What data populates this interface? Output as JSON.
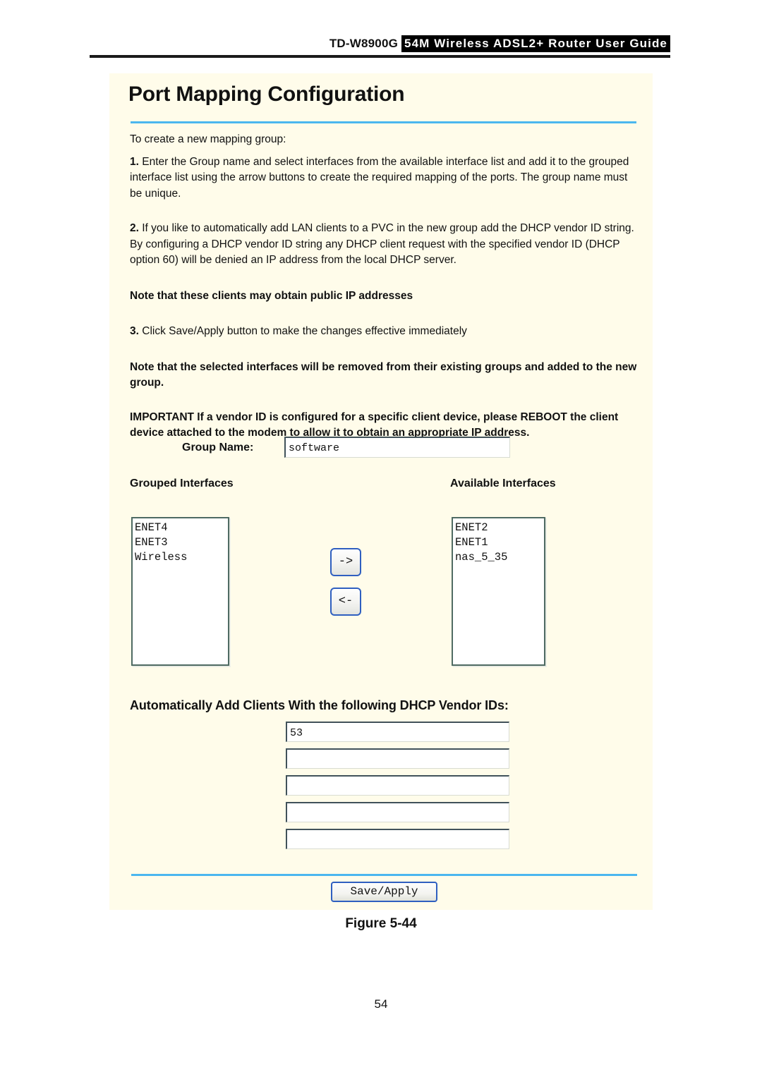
{
  "header": {
    "model": "TD-W8900G",
    "product": "54M Wireless ADSL2+ Router User Guide"
  },
  "panel": {
    "title": "Port Mapping Configuration",
    "intro": "To create a new mapping group:",
    "step1_num": "1.",
    "step1_text": " Enter the Group name and select interfaces from the available interface list and add it to the grouped interface list using the arrow buttons to create the required mapping of the ports. The group name must be unique.",
    "step2_num": "2.",
    "step2_text": " If you like to automatically add LAN clients to a PVC in the new group add the DHCP vendor ID string. By configuring a DHCP vendor ID string any DHCP client request with the specified vendor ID (DHCP option 60) will be denied an IP address from the local DHCP server.",
    "note1": "Note that these clients may obtain public IP addresses",
    "step3_num": "3.",
    "step3_text": " Click Save/Apply button to make the changes effective immediately",
    "note2": "Note that the selected interfaces will be removed from their existing groups and added to the new group.",
    "note3": "IMPORTANT If a vendor ID is configured for a specific client device, please REBOOT the client device attached to the modem to allow it to obtain an appropriate IP address."
  },
  "form": {
    "group_name_label": "Group Name:",
    "group_name_value": "software",
    "group_name_placeholder": "",
    "grouped_heading": "Grouped Interfaces",
    "available_heading": "Available Interfaces",
    "grouped_interfaces": [
      "ENET4",
      "ENET3",
      "Wireless"
    ],
    "available_interfaces": [
      "ENET2",
      "ENET1",
      "nas_5_35"
    ],
    "arrow_right_label": "->",
    "arrow_left_label": "<-",
    "vendor_heading": "Automatically Add Clients With the following DHCP Vendor IDs:",
    "vendor_ids": [
      "53",
      "",
      "",
      "",
      ""
    ],
    "vendor_placeholder": "",
    "save_apply_label": "Save/Apply"
  },
  "figure": {
    "caption": "Figure 5-44"
  },
  "page": {
    "number": "54"
  },
  "colors": {
    "panel_background": "#fffcea",
    "rule_blue": "#4bb7ef",
    "header_black": "#000000",
    "button_border_blue": "#2f5fc0",
    "listbox_border": "#4f6b63"
  }
}
